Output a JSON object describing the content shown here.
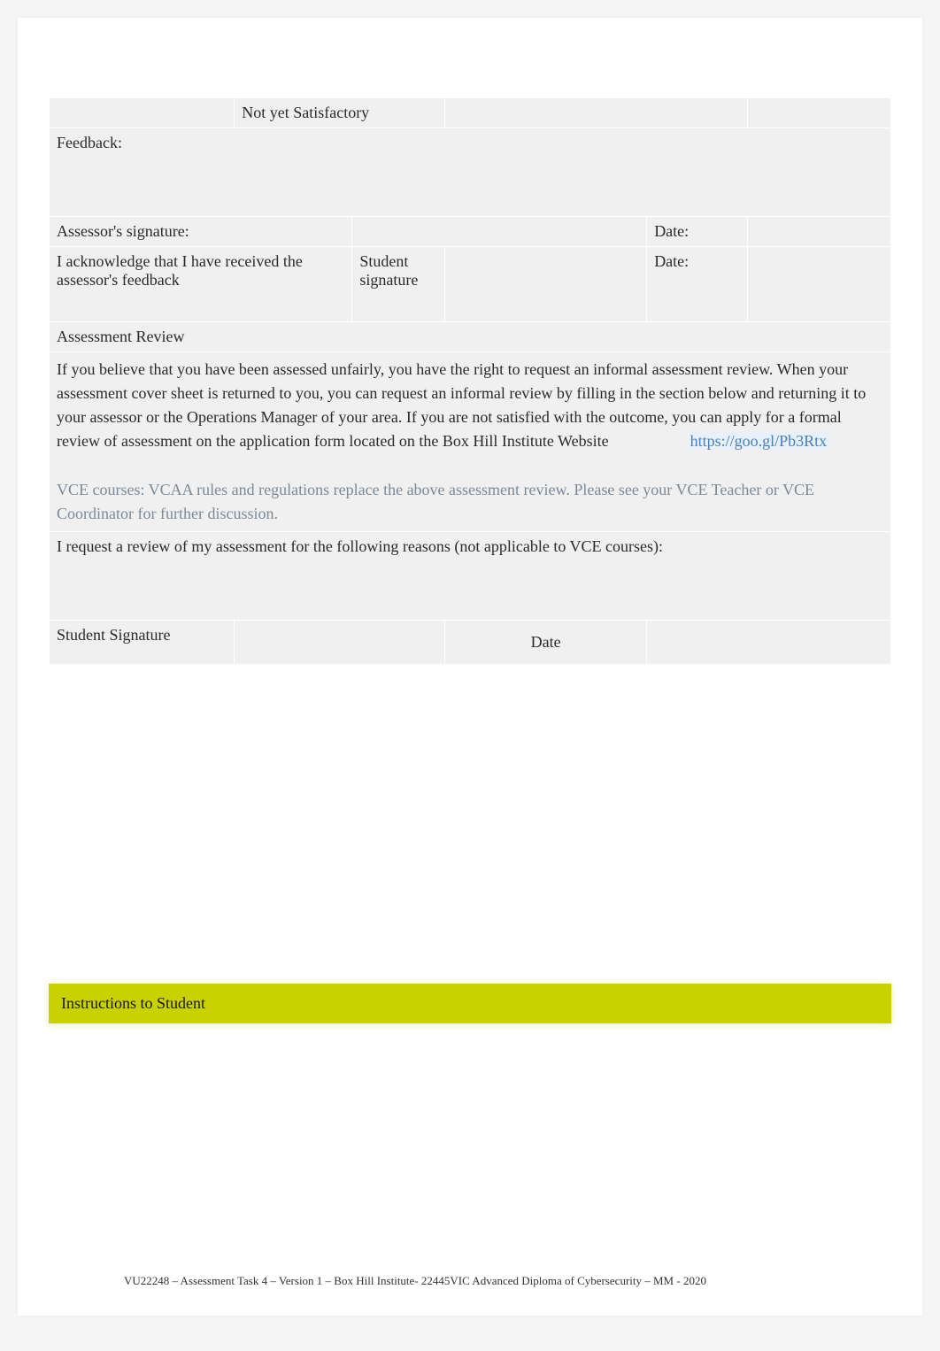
{
  "outcome": {
    "not_yet_satisfactory": "Not yet Satisfactory"
  },
  "feedback": {
    "label": "Feedback:"
  },
  "assessor": {
    "signature_label": "Assessor's signature:",
    "date_label": "Date:"
  },
  "acknowledgement": {
    "text": "I acknowledge that I have received the assessor's feedback",
    "student_signature_label": "Student signature",
    "date_label": "Date:"
  },
  "review": {
    "header": "Assessment Review",
    "body_part1": "If you believe that you have been assessed unfairly, you have the right to request an informal assessment review.        When your assessment cover sheet is returned to you, you can request an informal review by filling in the section below and returning it to your assessor or the Operations Manager of your area.                  If you are not satisfied with the outcome, you can apply for a formal review of assessment on the application form located on the Box Hill Institute Website",
    "link": "https://goo.gl/Pb3Rtx",
    "vce_text": "VCE courses:        VCAA rules and regulations replace the above assessment review.        Please see your VCE Teacher or VCE Coordinator for further discussion."
  },
  "request": {
    "label": "I request a review of my assessment for the following reasons (not applicable to VCE courses):"
  },
  "signature_row": {
    "student_signature": "Student Signature",
    "date": "Date"
  },
  "instructions": {
    "heading": "Instructions to Student"
  },
  "footer": {
    "text": "VU22248 – Assessment Task 4 – Version 1 – Box Hill Institute- 22445VIC Advanced Diploma of Cybersecurity – MM - 2020"
  }
}
